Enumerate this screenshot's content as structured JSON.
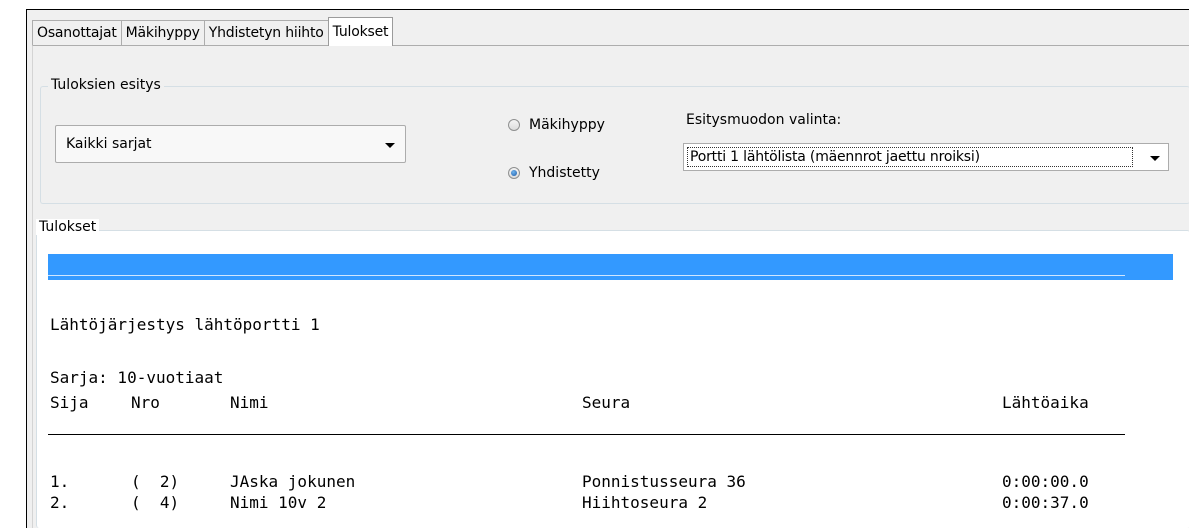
{
  "tabs": [
    "Osanottajat",
    "Mäkihyppy",
    "Yhdistetyn hiihto",
    "Tulokset"
  ],
  "active_tab": "Tulokset",
  "display_group": {
    "legend": "Tuloksien esitys",
    "series_select": "Kaikki sarjat",
    "radio_ski_jump": "Mäkihyppy",
    "radio_combined": "Yhdistetty",
    "radio_selected": "Yhdistetty",
    "format_label": "Esitysmuodon valinta:",
    "format_select": "Portti 1 lähtölista (mäennrot jaettu nroiksi)"
  },
  "results": {
    "legend": "Tulokset",
    "heading": "Lähtöjärjestys lähtöportti 1",
    "series": "Sarja: 10-vuotiaat",
    "columns": [
      "Sija",
      "Nro",
      "Nimi",
      "Seura",
      "Lähtöaika"
    ],
    "rows": [
      {
        "rank": "1.",
        "nro": "(  2)",
        "name": "JAska jokunen",
        "club": "Ponnistusseura 36",
        "time": "0:00:00.0"
      },
      {
        "rank": "2.",
        "nro": "(  4)",
        "name": "Nimi 10v 2",
        "club": "Hiihtoseura 2",
        "time": "0:00:37.0"
      }
    ]
  },
  "colors": {
    "selection": "#3399ff",
    "panel": "#f0f0f0"
  }
}
